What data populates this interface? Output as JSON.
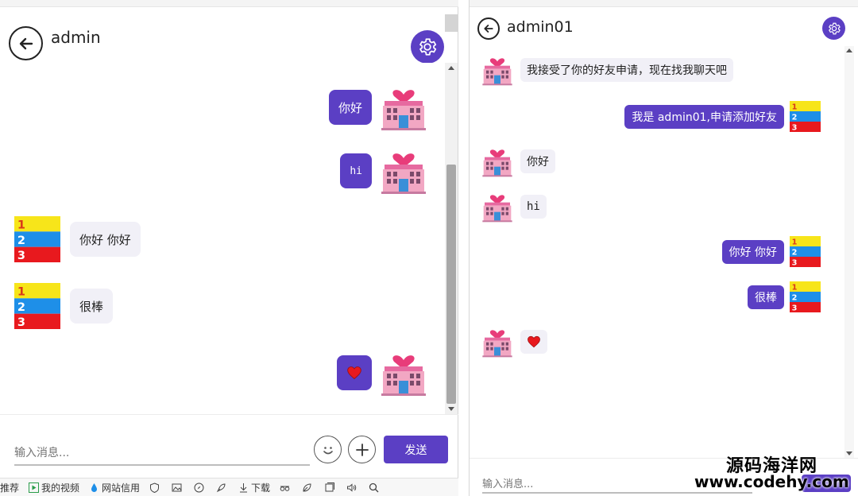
{
  "left_panel": {
    "title": "admin",
    "messages": [
      {
        "side": "me",
        "text": "你好"
      },
      {
        "side": "me",
        "text": "hi"
      },
      {
        "side": "other",
        "text": "你好  你好"
      },
      {
        "side": "other",
        "text": "很棒"
      },
      {
        "side": "me",
        "text": "",
        "emoji": "heart"
      }
    ],
    "input_placeholder": "输入消息...",
    "send_label": "发送"
  },
  "right_panel": {
    "title": "admin01",
    "messages": [
      {
        "side": "other",
        "text": "我接受了你的好友申请，现在找我聊天吧"
      },
      {
        "side": "me",
        "text": "我是 admin01,申请添加好友"
      },
      {
        "side": "other",
        "text": "你好"
      },
      {
        "side": "other",
        "text": "hi"
      },
      {
        "side": "me",
        "text": "你好  你好"
      },
      {
        "side": "me",
        "text": "很棒"
      },
      {
        "side": "other",
        "text": "",
        "emoji": "heart"
      }
    ],
    "input_placeholder": "输入消息..."
  },
  "taskbar": {
    "items": [
      "推荐",
      "我的视频",
      "网站信用",
      "下载"
    ]
  },
  "watermark": {
    "line1": "源码海洋网",
    "line2": "www.codehy.com"
  },
  "colors": {
    "accent": "#5b3fc4",
    "bubble_other": "#f1f0f7"
  }
}
